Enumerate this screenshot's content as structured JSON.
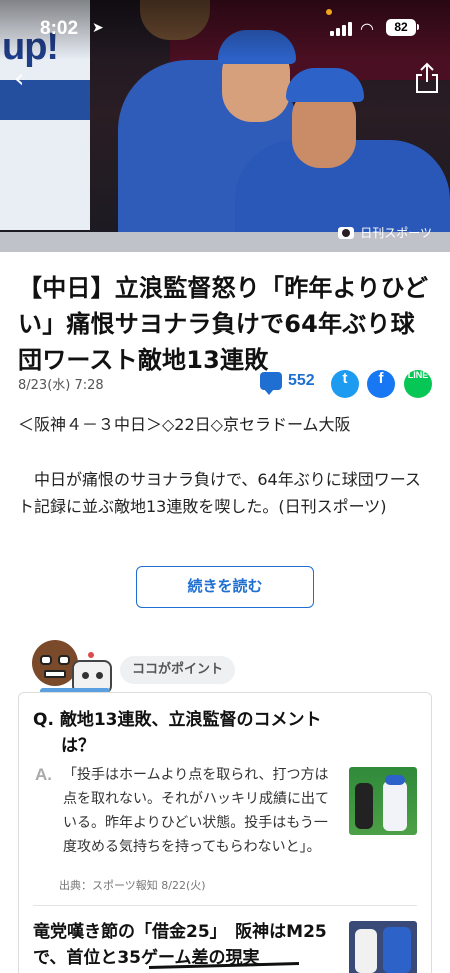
{
  "status_bar": {
    "time": "8:02",
    "battery": "82"
  },
  "hero": {
    "wall_text": "up!",
    "photo_credit": "日刊スポーツ"
  },
  "article": {
    "title": "【中日】立浪監督怒り「昨年よりひどい」痛恨サヨナラ負けで64年ぶり球団ワースト敵地13連敗",
    "date": "8/23(水) 7:28",
    "comment_count": "552",
    "lead": "＜阪神４－３中日＞◇22日◇京セラドーム大阪",
    "body": "中日が痛恨のサヨナラ負けで、64年ぶりに球団ワースト記録に並ぶ敵地13連敗を喫した。(日刊スポーツ)",
    "read_more": "続きを読む"
  },
  "share": {
    "twitter": "t",
    "facebook": "f",
    "line": "LINE"
  },
  "point": {
    "label": "ココがポイント",
    "question_prefix": "Q.",
    "question": "敵地13連敗、立浪監督のコメントは？",
    "answer_prefix": "A.",
    "answer": "「投手はホームより点を取られ、打つ方は点を取れない。それがハッキリ成績に出ている。昨年よりひどい状態。投手はもう一度攻める気持ちを持ってもらわないと」。",
    "source": "出典：スポーツ報知 8/22(火)",
    "related_title": "竜党嘆き節の「借金25」　阪神はM25で、首位と35ゲーム差の現実"
  },
  "colors": {
    "accent": "#1e6fd1",
    "twitter": "#1d9bf0",
    "facebook": "#1877f2",
    "line": "#06c755"
  }
}
